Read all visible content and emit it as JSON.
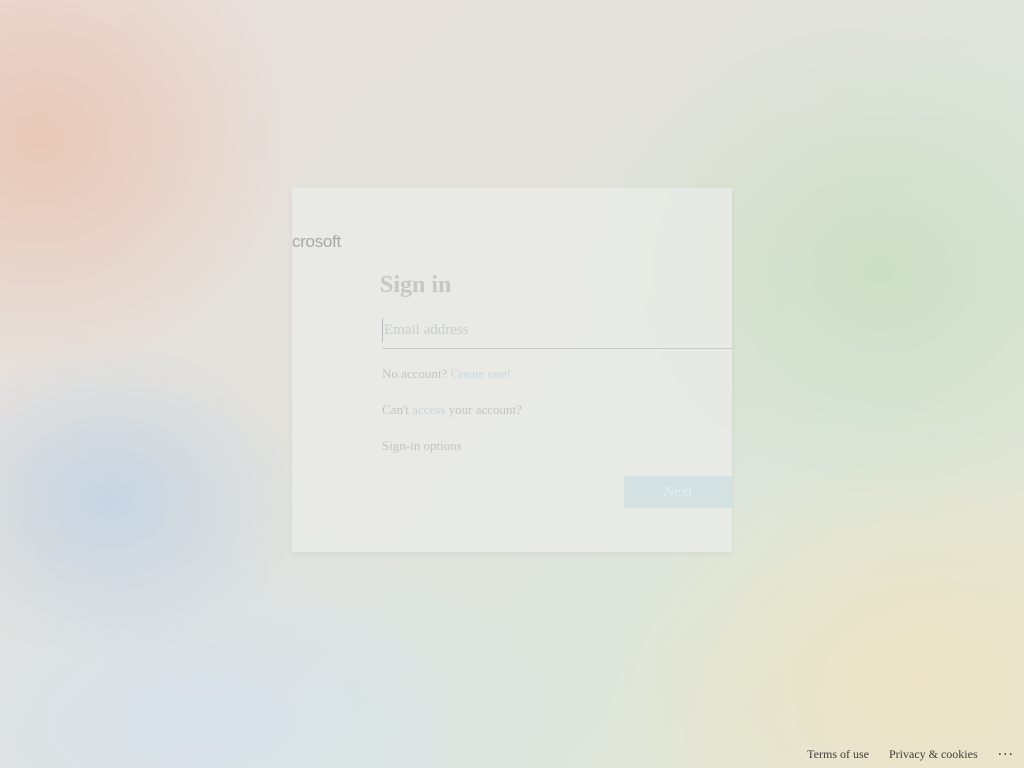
{
  "logo": {
    "text": "crosoft"
  },
  "signin": {
    "title": "Sign in",
    "email_placeholder": "Email address",
    "email_value": "",
    "no_account_text": "No account?",
    "create_one_link": "Create one!",
    "cant_access_prefix": "Can't ",
    "cant_access_link": "access",
    "cant_access_suffix": " your account?",
    "signin_options_text": "Sign-in options",
    "next_label": "Next"
  },
  "footer": {
    "terms_label": "Terms of use",
    "privacy_label": "Privacy & cookies",
    "more_label": "..."
  },
  "colors": {
    "accent": "#d3e1e3",
    "footer_text": "#3e3e3e"
  }
}
